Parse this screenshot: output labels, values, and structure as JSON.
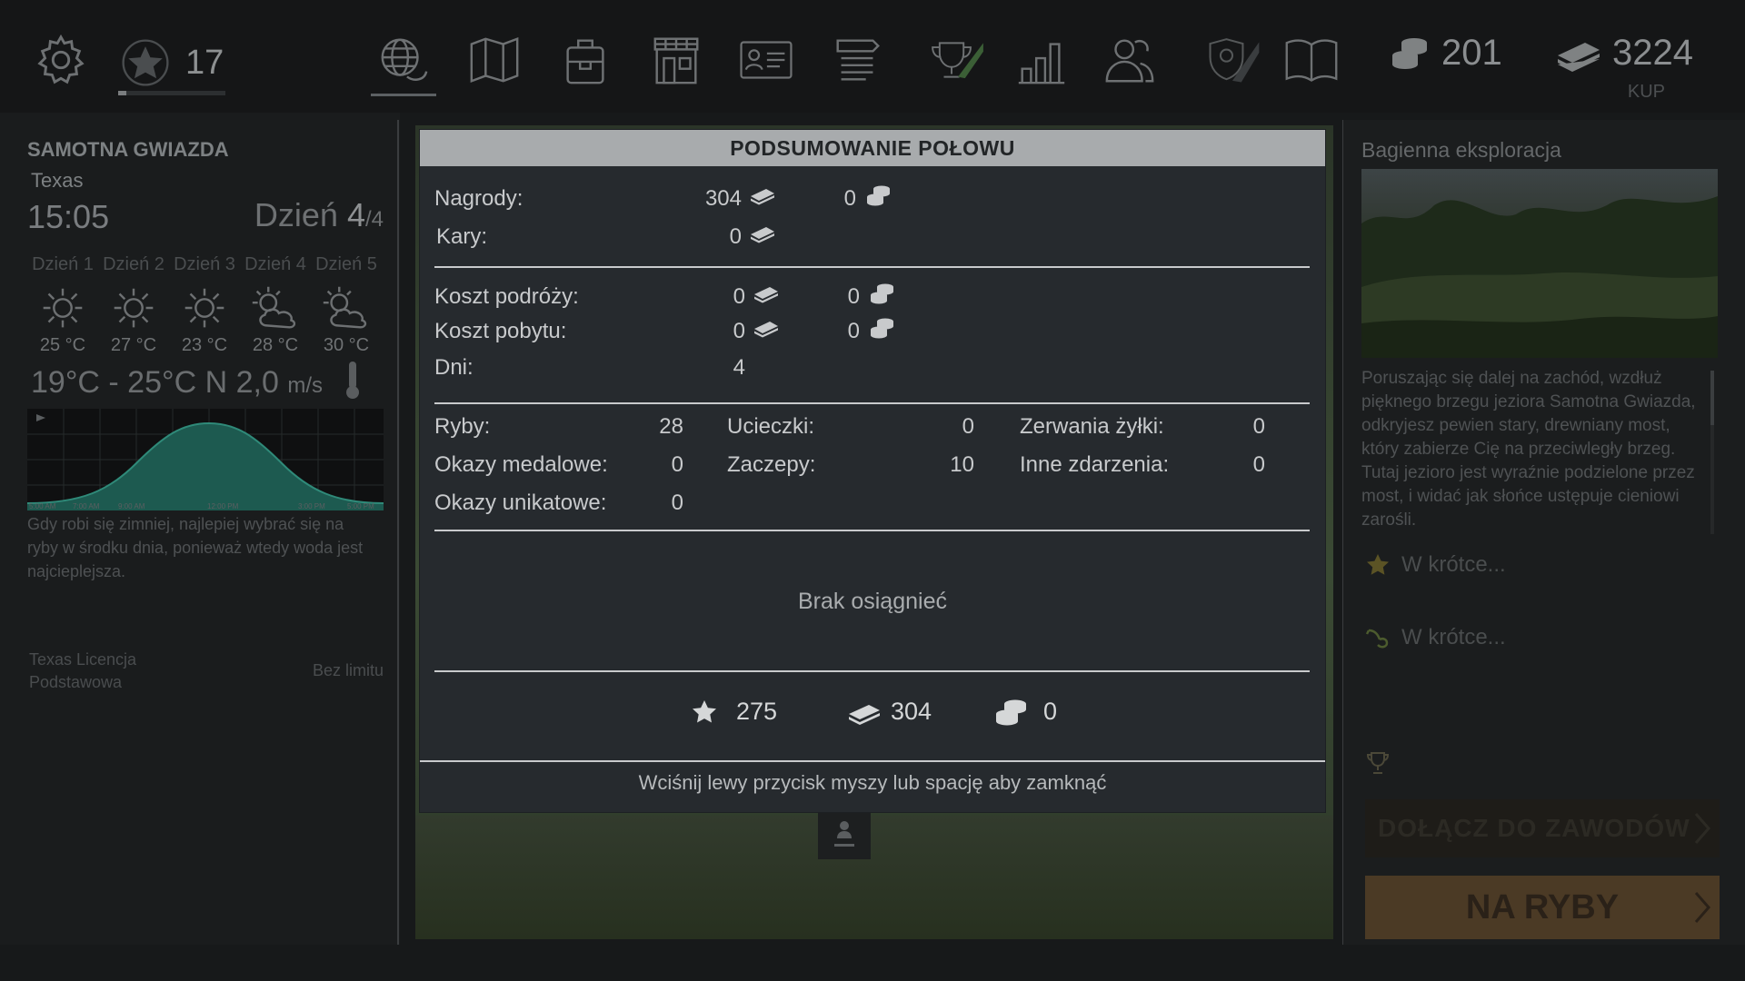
{
  "topbar": {
    "settings_icon": "gear-icon",
    "level": "17",
    "level_progress": 0.08,
    "nav_icons": [
      "globe-icon",
      "map-icon",
      "backpack-icon",
      "shop-icon",
      "profile-card-icon",
      "tasks-icon",
      "trophy-beta-icon",
      "stats-icon",
      "friends-icon",
      "clan-icon",
      "book-icon"
    ],
    "coins": "201",
    "money": "3224",
    "buy_label": "KUP"
  },
  "left": {
    "location": "SAMOTNA GWIAZDA",
    "state": "Texas",
    "time": "15:05",
    "day_prefix": "Dzień",
    "day_current": "4",
    "day_total": "/4",
    "forecast": [
      {
        "day": "Dzień 1",
        "temp": "25 °C",
        "icon": "sun-icon"
      },
      {
        "day": "Dzień 2",
        "temp": "27 °C",
        "icon": "sun-icon"
      },
      {
        "day": "Dzień 3",
        "temp": "23 °C",
        "icon": "sun-icon"
      },
      {
        "day": "Dzień 4",
        "temp": "28 °C",
        "icon": "partly-cloudy-icon"
      },
      {
        "day": "Dzień 5",
        "temp": "30 °C",
        "icon": "partly-cloudy-icon"
      }
    ],
    "temp_range": "19°C - 25°C",
    "wind": "N 2,0",
    "wind_unit": "m/s",
    "graph_labels": [
      "5:00 AM",
      "7:00 AM",
      "9:00 AM",
      "12:00 PM",
      "3:00 PM",
      "5:00 PM"
    ],
    "tip": "Gdy robi się zimniej, najlepiej wybrać się na ryby w środku dnia, ponieważ wtedy woda jest najcieplejsza.",
    "license_line1": "Texas Licencja",
    "license_line2": "Podstawowa",
    "license_limit": "Bez limitu"
  },
  "right": {
    "title": "Bagienna eksploracja",
    "description": "Poruszając się dalej na zachód, wzdłuż pięknego brzegu jeziora Samotna Gwiazda, odkryjesz pewien stary, drewniany most, który zabierze Cię na przeciwległy brzeg. Tutaj jezioro jest wyraźnie podzielone przez most, i widać jak słońce ustępuje cieniowi zarośli.",
    "row1": "W krótce...",
    "row2": "W krótce...",
    "join_button": "DOŁĄCZ DO ZAWODÓW",
    "fish_button": "NA RYBY"
  },
  "modal": {
    "title": "PODSUMOWANIE POŁOWU",
    "rewards_label": "Nagrody:",
    "rewards_money": "304",
    "rewards_coins": "0",
    "penalties_label": "Kary:",
    "penalties_money": "0",
    "travel_label": "Koszt podróży:",
    "travel_money": "0",
    "travel_coins": "0",
    "stay_label": "Koszt pobytu:",
    "stay_money": "0",
    "stay_coins": "0",
    "days_label": "Dni:",
    "days_value": "4",
    "fish_label": "Ryby:",
    "fish_value": "28",
    "escapes_label": "Ucieczki:",
    "escapes_value": "0",
    "line_breaks_label": "Zerwania żyłki:",
    "line_breaks_value": "0",
    "medal_label": "Okazy medalowe:",
    "medal_value": "0",
    "snags_label": "Zaczepy:",
    "snags_value": "10",
    "other_label": "Inne zdarzenia:",
    "other_value": "0",
    "unique_label": "Okazy unikatowe:",
    "unique_value": "0",
    "no_achievements": "Brak osiągnieć",
    "total_exp": "275",
    "total_money": "304",
    "total_coins": "0",
    "footer": "Wciśnij lewy przycisk myszy lub spację aby zamknąć"
  }
}
